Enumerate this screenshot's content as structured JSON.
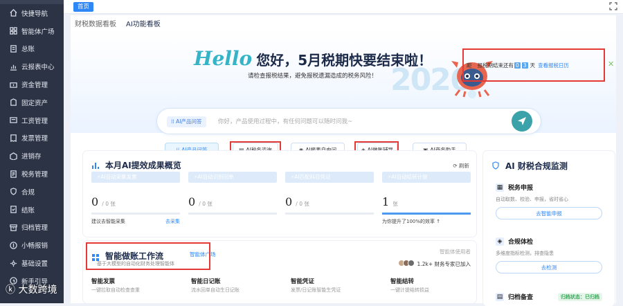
{
  "sidebar": {
    "items": [
      {
        "label": "快捷导航",
        "icon": "home-icon"
      },
      {
        "label": "智能体广场",
        "icon": "grid-icon"
      },
      {
        "label": "总账",
        "icon": "ledger-icon"
      },
      {
        "label": "云报表中心",
        "icon": "chart-icon"
      },
      {
        "label": "资金管理",
        "icon": "money-icon"
      },
      {
        "label": "固定资产",
        "icon": "asset-icon"
      },
      {
        "label": "工资管理",
        "icon": "salary-icon"
      },
      {
        "label": "发票管理",
        "icon": "invoice-icon"
      },
      {
        "label": "进销存",
        "icon": "stock-icon"
      },
      {
        "label": "税务管理",
        "icon": "tax-icon"
      },
      {
        "label": "合规",
        "icon": "shield-icon"
      },
      {
        "label": "结账",
        "icon": "close-books-icon"
      },
      {
        "label": "归档管理",
        "icon": "archive-icon"
      },
      {
        "label": "小畅报销",
        "icon": "reimburse-icon"
      },
      {
        "label": "基础设置",
        "icon": "settings-icon"
      },
      {
        "label": "新手引导",
        "icon": "guide-icon"
      }
    ]
  },
  "topbar": {
    "home_tag": "首页"
  },
  "subtabs": [
    "财税数据看板",
    "AI功能看板"
  ],
  "hero": {
    "hello": "Hello",
    "headline": "您好，5月税期快要结束啦！",
    "subtitle": "请检查报税结果，避免报税遗漏造成的税务风险！",
    "year": "2026",
    "deadline": {
      "prefix": "距",
      "text": "报税期结束还有",
      "d1": "0",
      "d2": "3",
      "unit": "天",
      "link": "查看报税日历"
    }
  },
  "search": {
    "chip": "AI产品问答",
    "placeholder": "你好，产品使用过程中，有任何问题可以随时问我~"
  },
  "quick_buttons": [
    "AI产品问答",
    "AI税务咨询",
    "AI报表自由问",
    "AI做账辅导",
    "AI商务助手"
  ],
  "metrics_card": {
    "title": "本月AI提效成果概览",
    "refresh": "刷新",
    "metrics": [
      {
        "label": "AI自动采集发票",
        "value": "0",
        "unit": "/ 0 张",
        "progress": 0,
        "foot_left": "建议去智能采集",
        "foot_right": "去采集"
      },
      {
        "label": "AI自动识别回单",
        "value": "0",
        "unit": "/ 0 张",
        "progress": 0,
        "foot_left": "",
        "foot_right": ""
      },
      {
        "label": "AI匹配科目凭证",
        "value": "0",
        "unit": "/ 0 张",
        "progress": 0,
        "foot_left": "",
        "foot_right": ""
      },
      {
        "label": "AI自动结转计提",
        "value": "1",
        "unit": "张",
        "progress": 100,
        "foot_left": "为你提升了100%的效率 ↑",
        "foot_right": ""
      }
    ]
  },
  "workflow_card": {
    "title": "智能做账工作流",
    "tag": "智能体广场",
    "subtitle": "基于大模型的自动化财务处理智能体",
    "right_label": "智能体使用者",
    "count": "1.2k+ 财务专家已加入",
    "items": [
      {
        "title": "智能发票",
        "desc": "一键拉取自动检查查重"
      },
      {
        "title": "智能日记账",
        "desc": "流水回单自动生日记账"
      },
      {
        "title": "智能凭证",
        "desc": "发票/日记账智能生凭证"
      },
      {
        "title": "智能结转",
        "desc": "一键计提结转损益"
      }
    ]
  },
  "compliance_card": {
    "title": "AI 财税合规监测",
    "sections": [
      {
        "title": "税务申报",
        "desc": "自动取数、校验、申报，省时省心",
        "button": "去智能申报"
      },
      {
        "title": "合规体检",
        "desc": "多维度指标检测，排查隐患",
        "button": "去检测"
      },
      {
        "title": "归档备查",
        "badge": "归档状态：已归档"
      }
    ]
  },
  "watermark": "大数跨境",
  "colors": {
    "accent": "#2f86f6",
    "sidebar": "#2b3345",
    "highlight": "#e53935"
  }
}
